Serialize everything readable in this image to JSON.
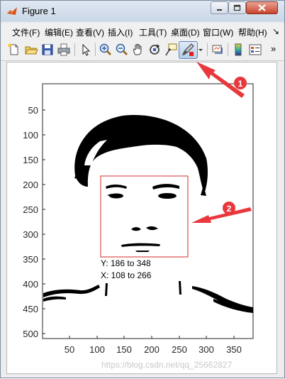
{
  "window": {
    "title": "Figure 1"
  },
  "menu": [
    {
      "label": "文件(F)"
    },
    {
      "label": "编辑(E)"
    },
    {
      "label": "查看(V)"
    },
    {
      "label": "插入(I)"
    },
    {
      "label": "工具(T)"
    },
    {
      "label": "桌面(D)"
    },
    {
      "label": "窗口(W)"
    },
    {
      "label": "帮助(H)"
    }
  ],
  "menu_overflow": "↘",
  "toolbar_overflow": "»",
  "toolbar": [
    {
      "icon": "new-figure-icon"
    },
    {
      "icon": "open-file-icon"
    },
    {
      "icon": "save-icon"
    },
    {
      "icon": "print-icon"
    },
    {
      "icon": "pointer-icon"
    },
    {
      "icon": "zoom-in-icon"
    },
    {
      "icon": "zoom-out-icon"
    },
    {
      "icon": "pan-icon"
    },
    {
      "icon": "rotate-3d-icon"
    },
    {
      "icon": "data-cursor-icon"
    },
    {
      "icon": "brush-icon",
      "active": true
    },
    {
      "icon": "link-plot-icon"
    },
    {
      "icon": "colorbar-icon"
    },
    {
      "icon": "legend-icon"
    }
  ],
  "axes": {
    "y_ticks": [
      "50",
      "100",
      "150",
      "200",
      "250",
      "300",
      "350",
      "400",
      "450",
      "500"
    ],
    "x_ticks": [
      "50",
      "100",
      "150",
      "200",
      "250",
      "300",
      "350"
    ]
  },
  "annotations": {
    "selection_y": "Y: 186 to 348",
    "selection_x": "X: 108 to 266",
    "callout_1": "1",
    "callout_2": "2"
  },
  "colors": {
    "callout": "#e8383d",
    "selection_border": "#d62b2b"
  },
  "watermark": "https://blog.csdn.net/qq_25662827"
}
